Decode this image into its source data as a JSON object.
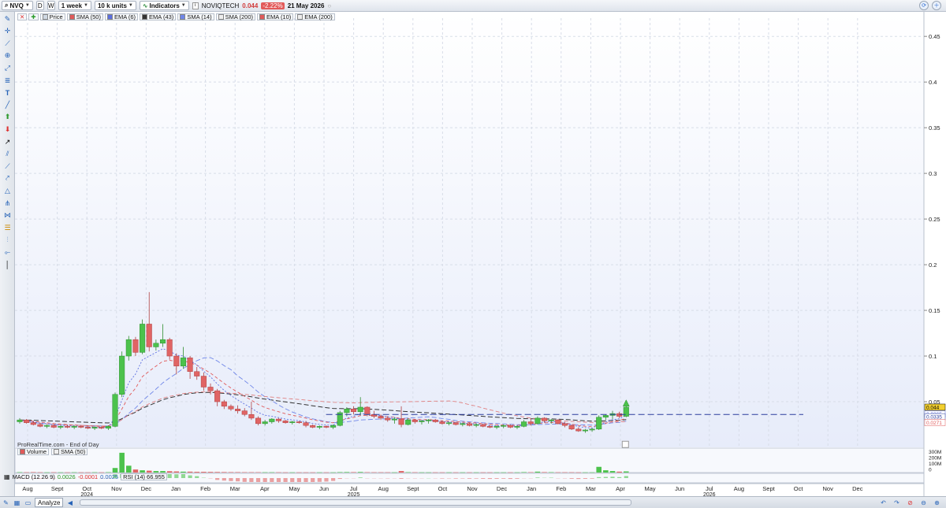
{
  "toolbar": {
    "symbol": "NVQ",
    "view_d": "D",
    "view_w": "W",
    "period": "1 week",
    "units": "10 k units",
    "indicators": "Indicators",
    "ticker_name": "NOVIQTECH",
    "last_price": "0.044",
    "change": "-2.22%",
    "date": "21 May 2026"
  },
  "legend": {
    "items": [
      {
        "label": "Price",
        "color": "#cfd8e3"
      },
      {
        "label": "SMA (50)",
        "color": "#e05a5a"
      },
      {
        "label": "EMA (6)",
        "color": "#5c6fe0"
      },
      {
        "label": "EMA (43)",
        "color": "#333333"
      },
      {
        "label": "SMA (14)",
        "color": "#6f86e8"
      },
      {
        "label": "SMA (200)",
        "color": "#e8e8e8"
      },
      {
        "label": "EMA (10)",
        "color": "#e05a5a"
      },
      {
        "label": "EMA (200)",
        "color": "#e8e8e8"
      }
    ],
    "source": "ProRealTime.com - End of Day"
  },
  "volume_panel": {
    "label": "Volume",
    "sma": "SMA (50)",
    "axis": [
      "300M",
      "200M",
      "100M",
      "0"
    ]
  },
  "indicator_panel": {
    "macd": "MACD (12 26 9)",
    "macd_v1": "0.0026",
    "macd_v2": "-0.0001",
    "macd_v3": "0.0025",
    "rsi": "RSI (14)",
    "rsi_v": "66.955"
  },
  "price_labels": {
    "last": "0.044",
    "l2": "0.0365",
    "l3": "0.0335",
    "l4": "0.0271"
  },
  "bottom": {
    "analyze": "Analyze"
  },
  "colors": {
    "up": "#4cc24c",
    "down": "#e06464",
    "bg": "#eef2fb"
  },
  "chart_data": {
    "type": "candlestick",
    "y_axis_ticks": [
      "0.45",
      "0.4",
      "0.35",
      "0.3",
      "0.25",
      "0.2",
      "0.15",
      "0.1",
      "0.05"
    ],
    "ylim": [
      0,
      0.47
    ],
    "x_labels": [
      {
        "label": "Aug",
        "year": ""
      },
      {
        "label": "Sept",
        "year": ""
      },
      {
        "label": "Oct",
        "year": "2024"
      },
      {
        "label": "Nov",
        "year": ""
      },
      {
        "label": "Dec",
        "year": ""
      },
      {
        "label": "Jan",
        "year": ""
      },
      {
        "label": "Feb",
        "year": ""
      },
      {
        "label": "Mar",
        "year": ""
      },
      {
        "label": "Apr",
        "year": ""
      },
      {
        "label": "May",
        "year": ""
      },
      {
        "label": "Jun",
        "year": ""
      },
      {
        "label": "Jul",
        "year": "2025"
      },
      {
        "label": "Aug",
        "year": ""
      },
      {
        "label": "Sept",
        "year": ""
      },
      {
        "label": "Oct",
        "year": ""
      },
      {
        "label": "Nov",
        "year": ""
      },
      {
        "label": "Dec",
        "year": ""
      },
      {
        "label": "Jan",
        "year": ""
      },
      {
        "label": "Feb",
        "year": ""
      },
      {
        "label": "Mar",
        "year": ""
      },
      {
        "label": "Apr",
        "year": ""
      },
      {
        "label": "May",
        "year": ""
      },
      {
        "label": "Jun",
        "year": ""
      },
      {
        "label": "Jul",
        "year": "2026"
      },
      {
        "label": "Aug",
        "year": ""
      },
      {
        "label": "Sept",
        "year": ""
      },
      {
        "label": "Oct",
        "year": ""
      },
      {
        "label": "Nov",
        "year": ""
      },
      {
        "label": "Dec",
        "year": ""
      }
    ],
    "candles": [
      [
        0.028,
        0.032,
        0.026,
        0.03
      ],
      [
        0.03,
        0.031,
        0.026,
        0.027
      ],
      [
        0.027,
        0.029,
        0.024,
        0.025
      ],
      [
        0.025,
        0.027,
        0.022,
        0.023
      ],
      [
        0.023,
        0.025,
        0.021,
        0.024
      ],
      [
        0.024,
        0.025,
        0.021,
        0.022
      ],
      [
        0.022,
        0.024,
        0.02,
        0.023
      ],
      [
        0.023,
        0.025,
        0.021,
        0.022
      ],
      [
        0.022,
        0.024,
        0.02,
        0.023
      ],
      [
        0.023,
        0.024,
        0.021,
        0.022
      ],
      [
        0.022,
        0.024,
        0.02,
        0.021
      ],
      [
        0.021,
        0.023,
        0.019,
        0.022
      ],
      [
        0.022,
        0.023,
        0.02,
        0.021
      ],
      [
        0.021,
        0.024,
        0.019,
        0.023
      ],
      [
        0.023,
        0.06,
        0.022,
        0.058
      ],
      [
        0.058,
        0.105,
        0.055,
        0.1
      ],
      [
        0.1,
        0.122,
        0.095,
        0.118
      ],
      [
        0.118,
        0.121,
        0.1,
        0.104
      ],
      [
        0.104,
        0.14,
        0.102,
        0.135
      ],
      [
        0.135,
        0.17,
        0.105,
        0.11
      ],
      [
        0.11,
        0.118,
        0.106,
        0.114
      ],
      [
        0.114,
        0.135,
        0.11,
        0.118
      ],
      [
        0.118,
        0.12,
        0.096,
        0.1
      ],
      [
        0.1,
        0.103,
        0.08,
        0.089
      ],
      [
        0.089,
        0.11,
        0.086,
        0.098
      ],
      [
        0.098,
        0.1,
        0.075,
        0.083
      ],
      [
        0.083,
        0.088,
        0.074,
        0.078
      ],
      [
        0.078,
        0.082,
        0.062,
        0.066
      ],
      [
        0.066,
        0.07,
        0.058,
        0.062
      ],
      [
        0.062,
        0.064,
        0.045,
        0.05
      ],
      [
        0.05,
        0.052,
        0.042,
        0.045
      ],
      [
        0.045,
        0.047,
        0.04,
        0.042
      ],
      [
        0.042,
        0.046,
        0.037,
        0.04
      ],
      [
        0.04,
        0.043,
        0.034,
        0.036
      ],
      [
        0.036,
        0.05,
        0.03,
        0.032
      ],
      [
        0.032,
        0.034,
        0.024,
        0.026
      ],
      [
        0.026,
        0.03,
        0.024,
        0.028
      ],
      [
        0.028,
        0.032,
        0.026,
        0.031
      ],
      [
        0.031,
        0.032,
        0.027,
        0.029
      ],
      [
        0.029,
        0.03,
        0.026,
        0.027
      ],
      [
        0.027,
        0.029,
        0.025,
        0.028
      ],
      [
        0.028,
        0.029,
        0.026,
        0.027
      ],
      [
        0.027,
        0.029,
        0.022,
        0.024
      ],
      [
        0.024,
        0.025,
        0.021,
        0.022
      ],
      [
        0.022,
        0.024,
        0.02,
        0.023
      ],
      [
        0.023,
        0.024,
        0.021,
        0.022
      ],
      [
        0.022,
        0.025,
        0.02,
        0.024
      ],
      [
        0.024,
        0.04,
        0.023,
        0.038
      ],
      [
        0.038,
        0.044,
        0.034,
        0.042
      ],
      [
        0.042,
        0.045,
        0.036,
        0.039
      ],
      [
        0.039,
        0.055,
        0.035,
        0.044
      ],
      [
        0.044,
        0.045,
        0.034,
        0.036
      ],
      [
        0.036,
        0.04,
        0.032,
        0.034
      ],
      [
        0.034,
        0.036,
        0.03,
        0.032
      ],
      [
        0.032,
        0.034,
        0.028,
        0.03
      ],
      [
        0.03,
        0.033,
        0.026,
        0.031
      ],
      [
        0.031,
        0.045,
        0.022,
        0.025
      ],
      [
        0.025,
        0.032,
        0.024,
        0.03
      ],
      [
        0.03,
        0.031,
        0.026,
        0.028
      ],
      [
        0.028,
        0.03,
        0.025,
        0.029
      ],
      [
        0.029,
        0.031,
        0.026,
        0.03
      ],
      [
        0.03,
        0.031,
        0.027,
        0.028
      ],
      [
        0.028,
        0.029,
        0.025,
        0.026
      ],
      [
        0.026,
        0.028,
        0.024,
        0.027
      ],
      [
        0.027,
        0.028,
        0.024,
        0.025
      ],
      [
        0.025,
        0.027,
        0.023,
        0.026
      ],
      [
        0.026,
        0.027,
        0.023,
        0.024
      ],
      [
        0.024,
        0.026,
        0.022,
        0.025
      ],
      [
        0.025,
        0.026,
        0.022,
        0.023
      ],
      [
        0.023,
        0.025,
        0.021,
        0.022
      ],
      [
        0.022,
        0.024,
        0.02,
        0.023
      ],
      [
        0.023,
        0.025,
        0.021,
        0.024
      ],
      [
        0.024,
        0.025,
        0.021,
        0.022
      ],
      [
        0.022,
        0.024,
        0.02,
        0.023
      ],
      [
        0.023,
        0.03,
        0.022,
        0.028
      ],
      [
        0.028,
        0.032,
        0.024,
        0.026
      ],
      [
        0.026,
        0.034,
        0.025,
        0.032
      ],
      [
        0.032,
        0.033,
        0.027,
        0.029
      ],
      [
        0.029,
        0.031,
        0.026,
        0.03
      ],
      [
        0.03,
        0.031,
        0.025,
        0.026
      ],
      [
        0.026,
        0.028,
        0.022,
        0.024
      ],
      [
        0.024,
        0.025,
        0.019,
        0.02
      ],
      [
        0.02,
        0.022,
        0.017,
        0.018
      ],
      [
        0.018,
        0.02,
        0.016,
        0.019
      ],
      [
        0.019,
        0.021,
        0.017,
        0.02
      ],
      [
        0.02,
        0.035,
        0.019,
        0.033
      ],
      [
        0.033,
        0.036,
        0.03,
        0.035
      ],
      [
        0.035,
        0.04,
        0.031,
        0.037
      ],
      [
        0.037,
        0.039,
        0.032,
        0.034
      ],
      [
        0.034,
        0.047,
        0.033,
        0.044
      ]
    ],
    "start_month_index": 0.0,
    "weeks_per_month": 4.35,
    "dashed_level": 0.036,
    "volume": [
      5,
      4,
      6,
      4,
      3,
      4,
      3,
      3,
      4,
      3,
      3,
      4,
      3,
      5,
      60,
      260,
      90,
      40,
      30,
      25,
      20,
      20,
      18,
      15,
      12,
      12,
      10,
      10,
      9,
      8,
      7,
      6,
      6,
      5,
      5,
      5,
      4,
      4,
      4,
      3,
      3,
      3,
      3,
      3,
      3,
      3,
      3,
      6,
      7,
      6,
      8,
      5,
      4,
      4,
      4,
      3,
      20,
      5,
      4,
      3,
      3,
      3,
      3,
      3,
      3,
      3,
      3,
      3,
      3,
      3,
      3,
      3,
      3,
      3,
      6,
      5,
      12,
      6,
      5,
      4,
      4,
      4,
      3,
      3,
      3,
      75,
      30,
      20,
      12,
      15
    ]
  }
}
